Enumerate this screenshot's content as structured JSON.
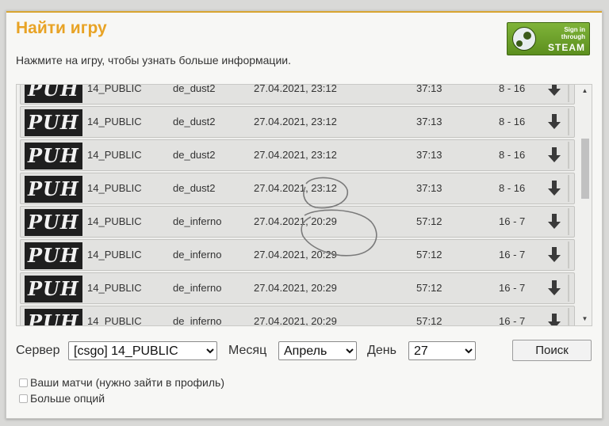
{
  "dialog": {
    "title": "Найти игру",
    "subtitle": "Нажмите на игру, чтобы узнать больше информации.",
    "steam_button": {
      "line1": "Sign in",
      "line2": "through",
      "line3": "STEAM"
    }
  },
  "matches": [
    {
      "server": "14_PUBLIC",
      "map": "de_dust2",
      "date": "27.04.2021, 23:12",
      "duration": "37:13",
      "score": "8 - 16"
    },
    {
      "server": "14_PUBLIC",
      "map": "de_dust2",
      "date": "27.04.2021, 23:12",
      "duration": "37:13",
      "score": "8 - 16"
    },
    {
      "server": "14_PUBLIC",
      "map": "de_dust2",
      "date": "27.04.2021, 23:12",
      "duration": "37:13",
      "score": "8 - 16"
    },
    {
      "server": "14_PUBLIC",
      "map": "de_dust2",
      "date": "27.04.2021, 23:12",
      "duration": "37:13",
      "score": "8 - 16"
    },
    {
      "server": "14_PUBLIC",
      "map": "de_inferno",
      "date": "27.04.2021, 20:29",
      "duration": "57:12",
      "score": "16 - 7"
    },
    {
      "server": "14_PUBLIC",
      "map": "de_inferno",
      "date": "27.04.2021, 20:29",
      "duration": "57:12",
      "score": "16 - 7"
    },
    {
      "server": "14_PUBLIC",
      "map": "de_inferno",
      "date": "27.04.2021, 20:29",
      "duration": "57:12",
      "score": "16 - 7"
    },
    {
      "server": "14_PUBLIC",
      "map": "de_inferno",
      "date": "27.04.2021, 20:29",
      "duration": "57:12",
      "score": "16 - 7"
    }
  ],
  "filters": {
    "server_label": "Сервер",
    "server_value": "[csgo] 14_PUBLIC",
    "month_label": "Месяц",
    "month_value": "Апрель",
    "day_label": "День",
    "day_value": "27",
    "search_button": "Поиск"
  },
  "options": {
    "my_matches": "Ваши матчи (нужно зайти в профиль)",
    "more_options": "Больше опций"
  },
  "colors": {
    "title": "#e8a325",
    "steam_green": "#6aa12a",
    "accent_bar": "#d8a530"
  },
  "icons": {
    "download": "arrow-down-icon",
    "steam": "steam-logo-icon"
  }
}
